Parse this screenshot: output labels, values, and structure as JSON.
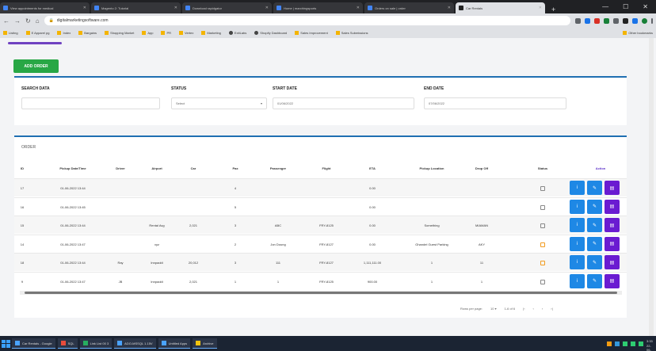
{
  "browser": {
    "tabs": [
      {
        "title": "View appointments for medical"
      },
      {
        "title": "Magento 2: Tutorial"
      },
      {
        "title": "Download rapidgator"
      },
      {
        "title": "Home | marchingsports"
      },
      {
        "title": "Orders on sale | order"
      },
      {
        "title": "Car Rentals"
      }
    ],
    "url": "digitalmarketingsoftware.com",
    "bookmarks": [
      "Listing",
      "E Apparel pg",
      "Index",
      "Bargains",
      "Shopping Market",
      "App",
      "PR",
      "Vertex",
      "Marketing",
      "ExitLabs",
      "Shopify Dashboard",
      "Sales Improvement",
      "Sales Submissions",
      "Other bookmarks"
    ]
  },
  "actions": {
    "add_order": "ADD ORDER"
  },
  "filters": {
    "search_label": "SEARCH DATA",
    "status_label": "STATUS",
    "status_value": "Select",
    "start_label": "START DATE",
    "start_value": "01/06/2022",
    "end_label": "END DATE",
    "end_value": "07/06/2022"
  },
  "orders": {
    "title": "ORDER",
    "headers": [
      "ID",
      "Pickup Date/Time",
      "Driver",
      "Airport",
      "Car",
      "Pax",
      "Passenger",
      "Flight",
      "ETA",
      "Pickup Location",
      "Drop Off",
      "Status",
      "Action"
    ],
    "rows": [
      [
        "17",
        "01-06-2022 13:44",
        "",
        "",
        "",
        "4",
        "",
        "",
        "0.00",
        "",
        "",
        ""
      ],
      [
        "16",
        "01-06-2022 13:45",
        "",
        "",
        "",
        "5",
        "",
        "",
        "0.00",
        "",
        "",
        ""
      ],
      [
        "15",
        "01-06-2022 13:44",
        "",
        "Rental Avg",
        "2,021",
        "3",
        "ABC",
        "FRY-8125",
        "0.00",
        "Something",
        "MIAMAN",
        ""
      ],
      [
        "14",
        "01-06-2022 13:47",
        "",
        "xyz",
        "",
        "2",
        "Jon Doung",
        "FRY-8127",
        "0.00",
        "Ghandel Guest Parking",
        "AKY",
        ""
      ],
      [
        "18",
        "01-06-2022 13:44",
        "Ray",
        "Innpaddi",
        "20,012",
        "3",
        "111",
        "FRY-8127",
        "1,111,111.00",
        "1",
        "11",
        ""
      ],
      [
        "9",
        "01-06-2022 13:47",
        "JB",
        "Innpaddi",
        "2,021",
        "1",
        "1",
        "FRY-8125",
        "900.00",
        "1",
        "1",
        ""
      ]
    ],
    "row_status_colors": [
      "#888888",
      "#888888",
      "#888888",
      "#f29b20",
      "#f29b20",
      "#888888"
    ],
    "pagination": {
      "rows_label": "Rows per page:",
      "rows_value": "10",
      "range": "1-6 of 6"
    }
  },
  "taskbar": {
    "items": [
      "Car Rentals - Google",
      "SQL",
      "Link List 00 3",
      "ADO-MSSQL 1.15V",
      "Untitled Apps",
      "Archive"
    ],
    "time": "3:33",
    "date": "22-06-2022"
  }
}
